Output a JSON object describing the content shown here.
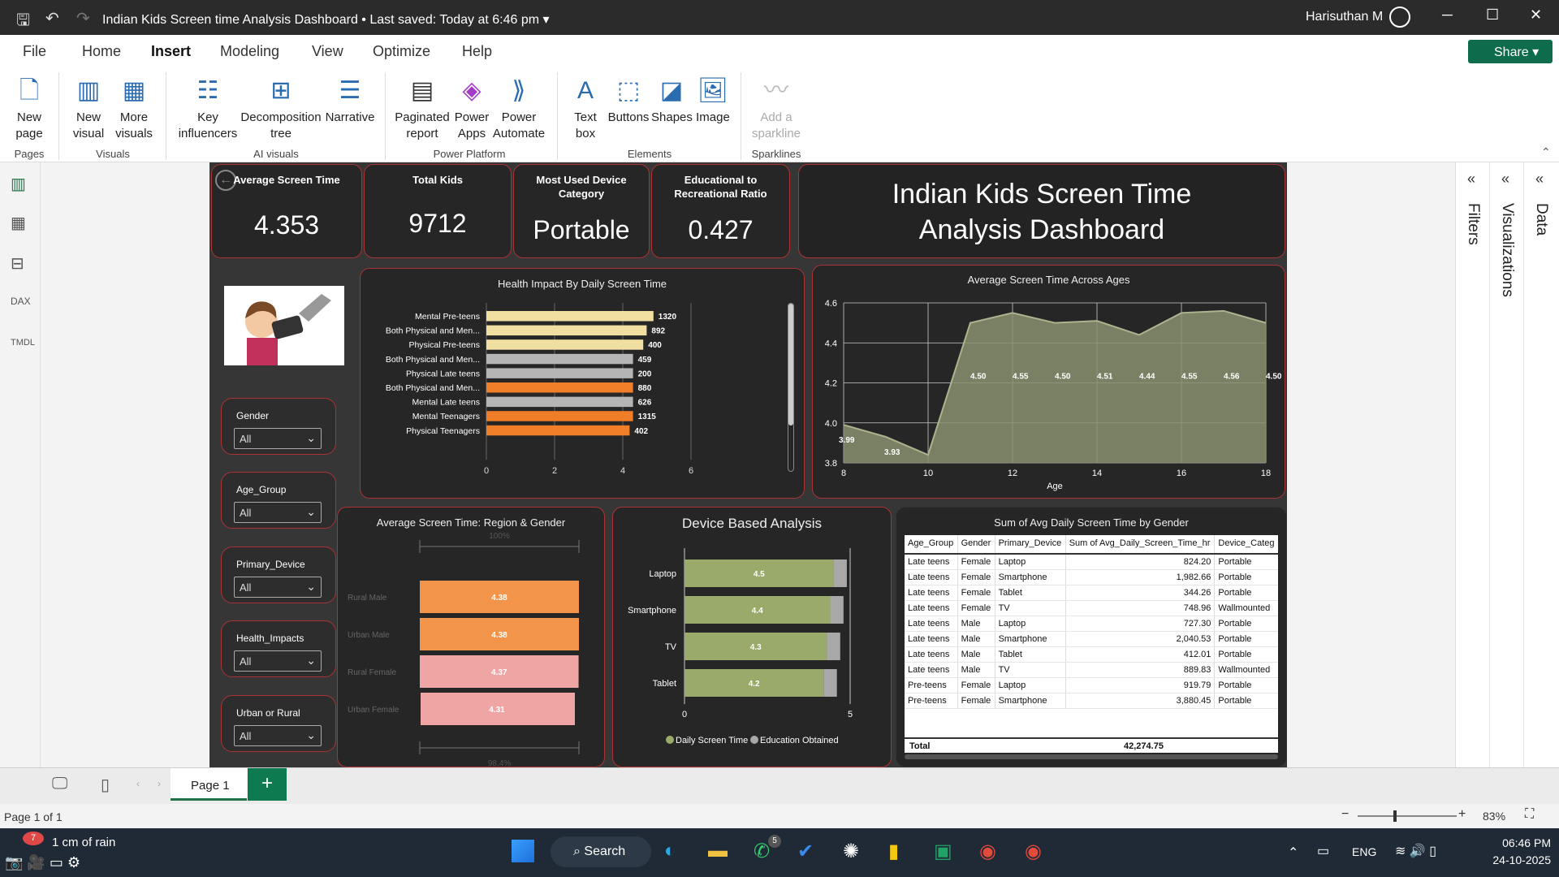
{
  "window": {
    "title": "Indian Kids Screen time Analysis Dashboard",
    "saved": "Last saved: Today at 6:46 pm",
    "user": "Harisuthan M"
  },
  "menu": {
    "items": [
      "File",
      "Home",
      "Insert",
      "Modeling",
      "View",
      "Optimize",
      "Help"
    ],
    "active": "Insert",
    "share": "Share"
  },
  "ribbon": {
    "new_page": "New page",
    "new_visual": "New visual",
    "more_visuals": "More visuals",
    "key_influencers": "Key influencers",
    "decomp_tree": "Decomposition tree",
    "narrative": "Narrative",
    "paginated": "Paginated report",
    "power_apps": "Power Apps",
    "power_automate": "Power Automate",
    "text_box": "Text box",
    "buttons": "Buttons",
    "shapes": "Shapes",
    "image": "Image",
    "sparkline": "Add a sparkline",
    "groups": {
      "pages": "Pages",
      "visuals": "Visuals",
      "ai": "AI visuals",
      "platform": "Power Platform",
      "elements": "Elements",
      "sparklines": "Sparklines"
    }
  },
  "kpis": {
    "avg_label": "Average Screen Time",
    "avg_value": "4.353",
    "kids_label": "Total Kids",
    "kids_value": "9712",
    "device_label": "Most Used Device Category",
    "device_value": "Portable",
    "ratio_label": "Educational to Recreational Ratio",
    "ratio_value": "0.427"
  },
  "dashboard_title": "Indian Kids Screen Time Analysis Dashboard",
  "slicers": [
    {
      "label": "Gender",
      "value": "All"
    },
    {
      "label": "Age_Group",
      "value": "All"
    },
    {
      "label": "Primary_Device",
      "value": "All"
    },
    {
      "label": "Health_Impacts",
      "value": "All"
    },
    {
      "label": "Urban or Rural",
      "value": "All"
    }
  ],
  "chart_data": [
    {
      "type": "bar",
      "title": "Health Impact By Daily Screen Time",
      "orientation": "horizontal",
      "categories": [
        "Mental Pre-teens",
        "Both Physical and Men...",
        "Physical Pre-teens",
        "Both Physical and Men...",
        "Physical Late teens",
        "Both Physical and Men...",
        "Mental Late teens",
        "Mental Teenagers",
        "Physical Teenagers"
      ],
      "values": [
        4.9,
        4.7,
        4.6,
        4.3,
        4.3,
        4.3,
        4.3,
        4.3,
        4.2
      ],
      "labels": [
        "1320",
        "892",
        "400",
        "459",
        "200",
        "880",
        "626",
        "1315",
        "402"
      ],
      "colors": [
        "#f0dfa0",
        "#f0dfa0",
        "#f0dfa0",
        "#b5b5b5",
        "#b5b5b5",
        "#f07d28",
        "#b5b5b5",
        "#f07d28",
        "#f07d28"
      ],
      "xticks": [
        "0",
        "2",
        "4",
        "6"
      ],
      "xlim": [
        0,
        6
      ]
    },
    {
      "type": "area",
      "title": "Average Screen Time Across Ages",
      "xlabel": "Age",
      "x": [
        8,
        9,
        10,
        11,
        12,
        13,
        14,
        15,
        16,
        17,
        18
      ],
      "y": [
        3.99,
        3.93,
        3.84,
        4.5,
        4.55,
        4.5,
        4.51,
        4.44,
        4.55,
        4.56,
        4.5
      ],
      "labels": [
        "3.99",
        "3.93",
        "",
        "4.50",
        "4.55",
        "4.50",
        "4.51",
        "4.44",
        "4.55",
        "4.56",
        "4.50"
      ],
      "xticks": [
        "8",
        "10",
        "12",
        "14",
        "16",
        "18"
      ],
      "yticks": [
        "3.8",
        "4.0",
        "4.2",
        "4.4",
        "4.6"
      ],
      "ylim": [
        3.8,
        4.6
      ]
    },
    {
      "type": "bar",
      "title": "Average Screen Time: Region & Gender",
      "orientation": "horizontal",
      "categories": [
        "Rural Male",
        "Urban Male",
        "Rural Female",
        "Urban Female"
      ],
      "values": [
        4.38,
        4.38,
        4.37,
        4.31
      ],
      "labels": [
        "4.38",
        "4.38",
        "4.37",
        "4.31"
      ],
      "colors": [
        "#f2954a",
        "#f2954a",
        "#f0a5a5",
        "#f0a5a5"
      ],
      "top_label": "100%",
      "bottom_label": "98.4%"
    },
    {
      "type": "bar",
      "title": "Device Based Analysis",
      "orientation": "horizontal",
      "categories": [
        "Laptop",
        "Smartphone",
        "TV",
        "Tablet"
      ],
      "series": [
        {
          "name": "Daily Screen Time",
          "values": [
            4.5,
            4.4,
            4.3,
            4.2
          ],
          "color": "#9aaa6a"
        },
        {
          "name": "Education Obtained",
          "values": [
            0.4,
            0.4,
            0.4,
            0.4
          ],
          "color": "#a8a8a8"
        }
      ],
      "labels": [
        "4.5",
        "4.4",
        "4.3",
        "4.2"
      ],
      "xticks": [
        "0",
        "5"
      ],
      "xlim": [
        0,
        5
      ]
    }
  ],
  "table": {
    "title": "Sum of Avg Daily Screen Time by Gender",
    "headers": [
      "Age_Group",
      "Gender",
      "Primary_Device",
      "Sum of Avg_Daily_Screen_Time_hr",
      "Device_Categ"
    ],
    "rows": [
      [
        "Late teens",
        "Female",
        "Laptop",
        "824.20",
        "Portable"
      ],
      [
        "Late teens",
        "Female",
        "Smartphone",
        "1,982.66",
        "Portable"
      ],
      [
        "Late teens",
        "Female",
        "Tablet",
        "344.26",
        "Portable"
      ],
      [
        "Late teens",
        "Female",
        "TV",
        "748.96",
        "Wallmounted"
      ],
      [
        "Late teens",
        "Male",
        "Laptop",
        "727.30",
        "Portable"
      ],
      [
        "Late teens",
        "Male",
        "Smartphone",
        "2,040.53",
        "Portable"
      ],
      [
        "Late teens",
        "Male",
        "Tablet",
        "412.01",
        "Portable"
      ],
      [
        "Late teens",
        "Male",
        "TV",
        "889.83",
        "Wallmounted"
      ],
      [
        "Pre-teens",
        "Female",
        "Laptop",
        "919.79",
        "Portable"
      ],
      [
        "Pre-teens",
        "Female",
        "Smartphone",
        "3,880.45",
        "Portable"
      ]
    ],
    "total_label": "Total",
    "total_value": "42,274.75"
  },
  "panes": {
    "filters": "Filters",
    "visualizations": "Visualizations",
    "data": "Data"
  },
  "page": {
    "tab": "Page 1",
    "status": "Page 1 of 1",
    "zoom": "83%"
  },
  "taskbar": {
    "weather": "1 cm of rain",
    "weather_badge": "7",
    "search": "Search",
    "whatsapp_badge": "5",
    "lang": "ENG",
    "time": "06:46 PM",
    "date": "24-10-2025"
  }
}
